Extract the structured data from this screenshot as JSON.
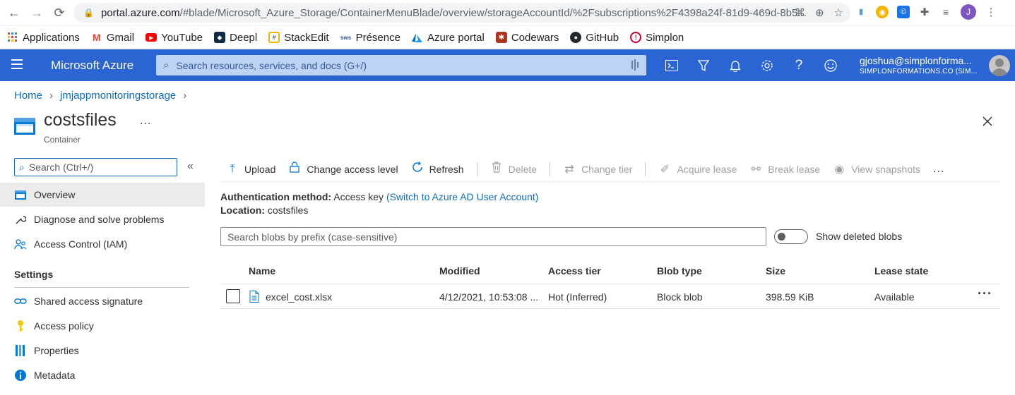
{
  "browser": {
    "url_host": "portal.azure.com",
    "url_path": "/#blade/Microsoft_Azure_Storage/ContainerMenuBlade/overview/storageAccountId/%2Fsubscriptions%2F4398a24f-81d9-469d-8b5...",
    "profile_initial": "J",
    "bookmarks": [
      {
        "label": "Applications",
        "icon": "apps-grid-icon"
      },
      {
        "label": "Gmail",
        "icon": "gmail-icon"
      },
      {
        "label": "YouTube",
        "icon": "youtube-icon"
      },
      {
        "label": "Deepl",
        "icon": "deepl-icon"
      },
      {
        "label": "StackEdit",
        "icon": "stackedit-icon"
      },
      {
        "label": "Présence",
        "icon": "presence-icon"
      },
      {
        "label": "Azure portal",
        "icon": "azure-icon"
      },
      {
        "label": "Codewars",
        "icon": "codewars-icon"
      },
      {
        "label": "GitHub",
        "icon": "github-icon"
      },
      {
        "label": "Simplon",
        "icon": "simplon-icon"
      }
    ]
  },
  "azure": {
    "title": "Microsoft Azure",
    "search_placeholder": "Search resources, services, and docs (G+/)",
    "user_email": "gjoshua@simplonforma...",
    "user_org": "SIMPLONFORMATIONS.CO (SIM...",
    "accent": "#2b65d3"
  },
  "breadcrumb": {
    "home": "Home",
    "storage": "jmjappmonitoringstorage"
  },
  "resource": {
    "title": "costsfiles",
    "subtitle": "Container",
    "more": "..."
  },
  "sidebar": {
    "search_placeholder": "Search (Ctrl+/)",
    "items": [
      {
        "label": "Overview"
      },
      {
        "label": "Diagnose and solve problems"
      },
      {
        "label": "Access Control (IAM)"
      }
    ],
    "section": "Settings",
    "settings_items": [
      {
        "label": "Shared access signature"
      },
      {
        "label": "Access policy"
      },
      {
        "label": "Properties"
      },
      {
        "label": "Metadata"
      }
    ]
  },
  "toolbar": {
    "upload": "Upload",
    "change_access": "Change access level",
    "refresh": "Refresh",
    "delete": "Delete",
    "change_tier": "Change tier",
    "acquire_lease": "Acquire lease",
    "break_lease": "Break lease",
    "view_snapshots": "View snapshots",
    "more": "..."
  },
  "info": {
    "auth_label": "Authentication method:",
    "auth_value": "Access key",
    "auth_link": "(Switch to Azure AD User Account)",
    "location_label": "Location:",
    "location_value": "costsfiles"
  },
  "blobs": {
    "search_placeholder": "Search blobs by prefix (case-sensitive)",
    "show_deleted_label": "Show deleted blobs",
    "show_deleted": false,
    "columns": [
      "Name",
      "Modified",
      "Access tier",
      "Blob type",
      "Size",
      "Lease state"
    ],
    "rows": [
      {
        "name": "excel_cost.xlsx",
        "modified": "4/12/2021, 10:53:08 ...",
        "access_tier": "Hot (Inferred)",
        "blob_type": "Block blob",
        "size": "398.59 KiB",
        "lease_state": "Available"
      }
    ]
  }
}
